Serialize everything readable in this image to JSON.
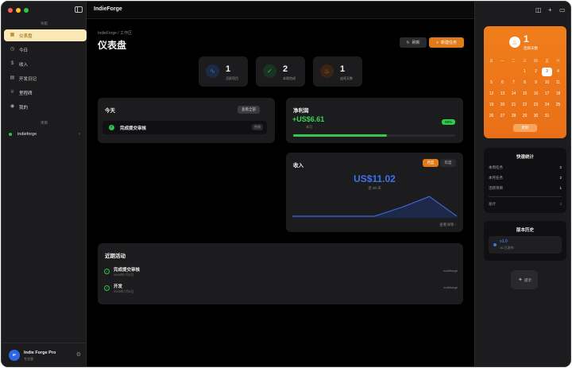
{
  "window": {
    "title": "IndieForge"
  },
  "sidebar": {
    "section_nav": "导航",
    "items": [
      {
        "label": "仪表盘",
        "icon": "grid-icon",
        "active": true
      },
      {
        "label": "今日",
        "icon": "clock-icon"
      },
      {
        "label": "收入",
        "icon": "dollar-icon"
      },
      {
        "label": "开发日记",
        "icon": "book-icon"
      },
      {
        "label": "里程碑",
        "icon": "trophy-icon"
      },
      {
        "label": "我的",
        "icon": "user-icon"
      }
    ],
    "section_projects": "项目",
    "project": {
      "name": "indieforge",
      "status_color": "#33c04a"
    },
    "user": {
      "initials": "IF",
      "name": "Indie Forge Pro",
      "plan": "专业版"
    }
  },
  "header": {
    "breadcrumb": "IndieForge / 工作区",
    "title": "仪表盘",
    "refresh_label": "刷新",
    "new_task_label": "新建任务"
  },
  "stats": [
    {
      "value": "1",
      "label": "活跃项目",
      "icon": "pulse-icon",
      "color": "#3e73ea"
    },
    {
      "value": "2",
      "label": "本周完成",
      "icon": "check-circle-icon",
      "color": "#2fbf4a"
    },
    {
      "value": "1",
      "label": "连续天数",
      "icon": "flame-icon",
      "color": "#e07a1a"
    }
  ],
  "today": {
    "title": "今天",
    "view_all": "查看全部",
    "task": {
      "label": "完成提交审核",
      "tag": "完成"
    }
  },
  "profit": {
    "title": "净利润",
    "value": "+US$6.61",
    "sub": "本月",
    "percent": "58%",
    "progress": 0.58
  },
  "revenue": {
    "title": "收入",
    "tab_day": "月度",
    "tab_year": "年度",
    "value": "US$11.02",
    "sub": "近 30 天",
    "details": "查看详情 ›",
    "chart_data": {
      "type": "area",
      "values": [
        0,
        0,
        0,
        0,
        2.1,
        4.6,
        0
      ]
    }
  },
  "activity": {
    "title": "近期活动",
    "items": [
      {
        "title": "完成提交审核",
        "date": "2026年7月3日",
        "project": "indieforge"
      },
      {
        "title": "开发",
        "date": "2026年7月3日",
        "project": "indieforge"
      }
    ]
  },
  "streak": {
    "value": "1",
    "label": "连续天数",
    "button": "更新",
    "weekdays": [
      "日",
      "一",
      "二",
      "三",
      "四",
      "五",
      "六"
    ],
    "weeks": [
      [
        "",
        "",
        "",
        "1",
        "2",
        "3",
        "4"
      ],
      [
        "5",
        "6",
        "7",
        "8",
        "9",
        "10",
        "11"
      ],
      [
        "12",
        "13",
        "14",
        "15",
        "16",
        "17",
        "18"
      ],
      [
        "19",
        "20",
        "21",
        "22",
        "23",
        "24",
        "25"
      ],
      [
        "26",
        "27",
        "28",
        "29",
        "30",
        "31",
        ""
      ]
    ],
    "today": "3"
  },
  "quick_stats": {
    "title": "快速统计",
    "rows": [
      {
        "label": "本周任务",
        "value": "2"
      },
      {
        "label": "本月任务",
        "value": "2"
      },
      {
        "label": "活跃项目",
        "value": "1"
      },
      {
        "label": "总计",
        "value": "2"
      }
    ]
  },
  "versions": {
    "title": "版本历史",
    "version": "v1.0",
    "date": "10-已发布"
  },
  "tip": {
    "label": "提示",
    "icon": "bulb-icon"
  }
}
